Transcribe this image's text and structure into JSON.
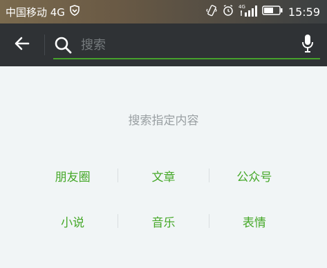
{
  "status_bar": {
    "carrier": "中国移动 4G",
    "network": "4G",
    "time": "15:59"
  },
  "search": {
    "placeholder": "搜索"
  },
  "content": {
    "hint": "搜索指定内容",
    "categories": [
      [
        "朋友圈",
        "文章",
        "公众号"
      ],
      [
        "小说",
        "音乐",
        "表情"
      ]
    ]
  },
  "colors": {
    "accent": "#45a828",
    "header": "#2f3235",
    "background": "#f1f5f6"
  }
}
